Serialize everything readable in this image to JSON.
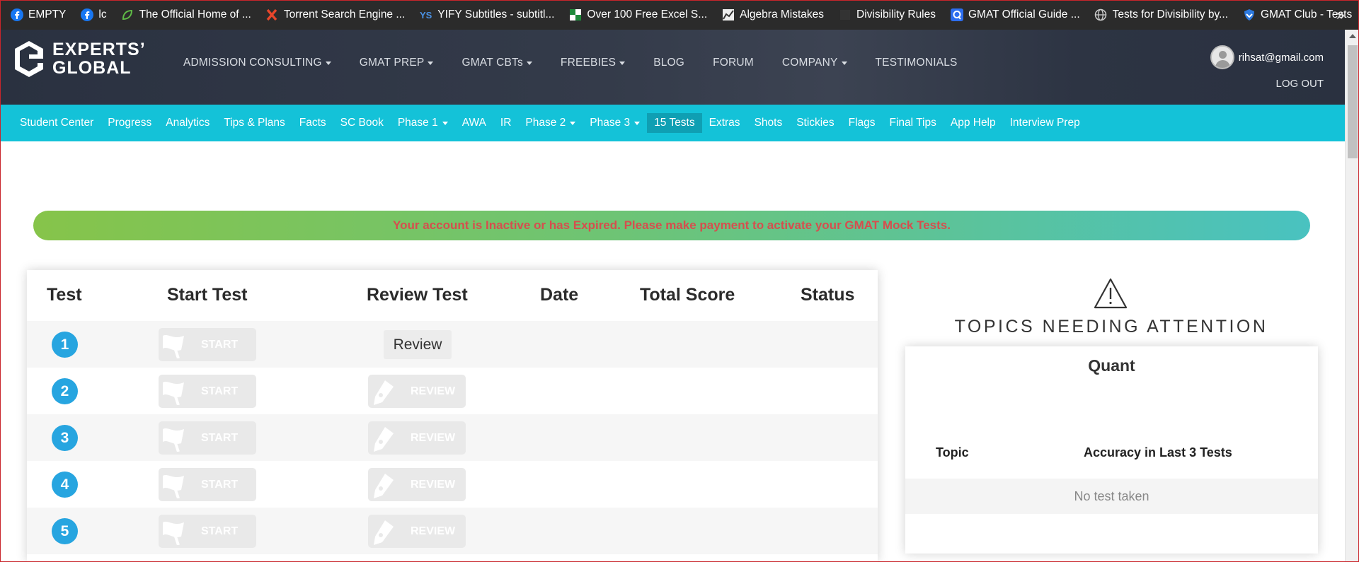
{
  "bookmarks": [
    {
      "label": "EMPTY",
      "icon": "facebook-icon"
    },
    {
      "label": "lc",
      "icon": "facebook-icon"
    },
    {
      "label": "The Official Home of ...",
      "icon": "leaf-icon"
    },
    {
      "label": "Torrent Search Engine ...",
      "icon": "x-icon"
    },
    {
      "label": "YIFY Subtitles - subtitl...",
      "icon": "yify-icon"
    },
    {
      "label": "Over 100 Free Excel S...",
      "icon": "excel-icon"
    },
    {
      "label": "Algebra Mistakes",
      "icon": "chart-icon"
    },
    {
      "label": "Divisibility Rules",
      "icon": "blank-icon"
    },
    {
      "label": "GMAT Official Guide ...",
      "icon": "q-icon"
    },
    {
      "label": "Tests for Divisibility by...",
      "icon": "globe-icon"
    },
    {
      "label": "GMAT Club - Tests",
      "icon": "shield-icon"
    }
  ],
  "header": {
    "logo_line1": "EXPERTS’",
    "logo_line2": "GLOBAL",
    "nav": [
      {
        "label": "ADMISSION CONSULTING",
        "dropdown": true
      },
      {
        "label": "GMAT PREP",
        "dropdown": true
      },
      {
        "label": "GMAT CBTs",
        "dropdown": true
      },
      {
        "label": "FREEBIES",
        "dropdown": true
      },
      {
        "label": "BLOG",
        "dropdown": false
      },
      {
        "label": "FORUM",
        "dropdown": false
      },
      {
        "label": "COMPANY",
        "dropdown": true
      },
      {
        "label": "TESTIMONIALS",
        "dropdown": false
      }
    ],
    "user_email": "rihsat@gmail.com",
    "logout_label": "LOG OUT"
  },
  "subnav": [
    {
      "label": "Student Center"
    },
    {
      "label": "Progress"
    },
    {
      "label": "Analytics"
    },
    {
      "label": "Tips & Plans"
    },
    {
      "label": "Facts"
    },
    {
      "label": "SC Book"
    },
    {
      "label": "Phase 1",
      "dropdown": true
    },
    {
      "label": "AWA"
    },
    {
      "label": "IR"
    },
    {
      "label": "Phase 2",
      "dropdown": true
    },
    {
      "label": "Phase 3",
      "dropdown": true
    },
    {
      "label": "15 Tests",
      "active": true
    },
    {
      "label": "Extras"
    },
    {
      "label": "Shots"
    },
    {
      "label": "Stickies"
    },
    {
      "label": "Flags"
    },
    {
      "label": "Final Tips"
    },
    {
      "label": "App Help"
    },
    {
      "label": "Interview Prep"
    }
  ],
  "alert": {
    "text": "Your account is Inactive or has Expired. Please make payment to activate your GMAT Mock Tests."
  },
  "tests_table": {
    "headers": {
      "test": "Test",
      "start": "Start Test",
      "review": "Review Test",
      "date": "Date",
      "score": "Total Score",
      "status": "Status"
    },
    "rows": [
      {
        "number": "1",
        "start_label": "START",
        "review_label": "Review"
      },
      {
        "number": "2",
        "start_label": "START",
        "review_label": "REVIEW"
      },
      {
        "number": "3",
        "start_label": "START",
        "review_label": "REVIEW"
      },
      {
        "number": "4",
        "start_label": "START",
        "review_label": "REVIEW"
      },
      {
        "number": "5",
        "start_label": "START",
        "review_label": "REVIEW"
      }
    ]
  },
  "topics_panel": {
    "title": "TOPICS NEEDING ATTENTION",
    "section": "Quant",
    "col_topic": "Topic",
    "col_accuracy": "Accuracy in Last 3 Tests",
    "empty_text": "No test taken"
  },
  "colors": {
    "subnav_bg": "#14c2d8",
    "alert_text": "#d64e4e",
    "test_number_bg": "#27a5e0",
    "header_bg": "#2f3645"
  }
}
